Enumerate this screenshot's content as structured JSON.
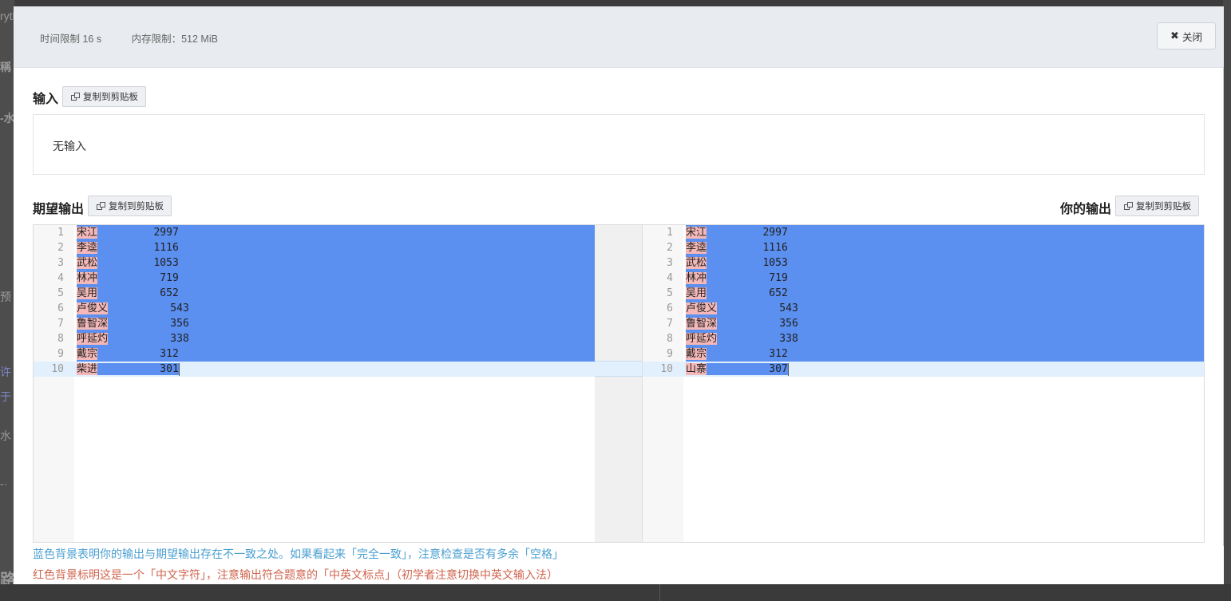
{
  "background": {
    "fragments": [
      "rytl",
      "稱",
      "-水",
      "预",
      "许",
      "于",
      "水",
      "-·",
      "路"
    ]
  },
  "header": {
    "time_limit": "时间限制 16 s",
    "memory_limit": "内存限制：512 MiB",
    "close_label": "关闭"
  },
  "input": {
    "title": "输入",
    "copy_label": "复制到剪贴板",
    "content": "无输入"
  },
  "expected": {
    "title": "期望输出",
    "copy_label": "复制到剪贴板",
    "lines": [
      {
        "n": "1",
        "name": "宋江",
        "pad": "         ",
        "value": "2997"
      },
      {
        "n": "2",
        "name": "李逵",
        "pad": "         ",
        "value": "1116"
      },
      {
        "n": "3",
        "name": "武松",
        "pad": "         ",
        "value": "1053"
      },
      {
        "n": "4",
        "name": "林冲",
        "pad": "          ",
        "value": "719"
      },
      {
        "n": "5",
        "name": "吴用",
        "pad": "          ",
        "value": "652"
      },
      {
        "n": "6",
        "name": "卢俊义",
        "pad": "          ",
        "value": "543"
      },
      {
        "n": "7",
        "name": "鲁智深",
        "pad": "          ",
        "value": "356"
      },
      {
        "n": "8",
        "name": "呼延灼",
        "pad": "          ",
        "value": "338"
      },
      {
        "n": "9",
        "name": "戴宗",
        "pad": "          ",
        "value": "312"
      },
      {
        "n": "10",
        "name": "柴进",
        "pad": "          ",
        "value": "301"
      }
    ]
  },
  "yours": {
    "title": "你的输出",
    "copy_label": "复制到剪贴板",
    "lines": [
      {
        "n": "1",
        "name": "宋江",
        "pad": "         ",
        "value": "2997"
      },
      {
        "n": "2",
        "name": "李逵",
        "pad": "         ",
        "value": "1116"
      },
      {
        "n": "3",
        "name": "武松",
        "pad": "         ",
        "value": "1053"
      },
      {
        "n": "4",
        "name": "林冲",
        "pad": "          ",
        "value": "719"
      },
      {
        "n": "5",
        "name": "吴用",
        "pad": "          ",
        "value": "652"
      },
      {
        "n": "6",
        "name": "卢俊义",
        "pad": "          ",
        "value": "543"
      },
      {
        "n": "7",
        "name": "鲁智深",
        "pad": "          ",
        "value": "356"
      },
      {
        "n": "8",
        "name": "呼延灼",
        "pad": "          ",
        "value": "338"
      },
      {
        "n": "9",
        "name": "戴宗",
        "pad": "          ",
        "value": "312"
      },
      {
        "n": "10",
        "name": "山寨",
        "pad": "          ",
        "value": "307"
      }
    ]
  },
  "notes": {
    "blue": "蓝色背景表明你的输出与期望输出存在不一致之处。如果看起来「完全一致」，注意检查是否有多余「空格」",
    "red": "红色背景标明这是一个「中文字符」，注意输出符合题意的「中英文标点」（初学者注意切换中英文输入法）"
  },
  "colors": {
    "diff_blue": "#5b8ff0",
    "cjk_red": "#f5b8b8",
    "note_blue": "#4a9fd1",
    "note_red": "#d0654f"
  }
}
